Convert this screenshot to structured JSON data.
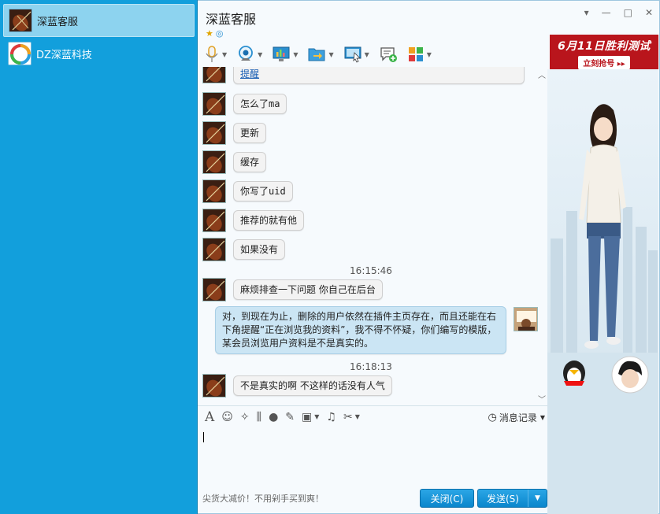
{
  "contacts": [
    {
      "name": "深蓝客服",
      "active": true
    },
    {
      "name": "DZ深蓝科技",
      "active": false
    }
  ],
  "chat": {
    "title": "深蓝客服",
    "window_controls": {
      "menu": "▾",
      "minimize": "—",
      "maximize": "□",
      "close": "✕"
    }
  },
  "ad": {
    "line1": "6月11日胜利测试",
    "line2": "立刻抢号 ▸▸"
  },
  "messages": [
    {
      "text": "提醒"
    },
    {
      "text": "怎么了ma"
    },
    {
      "text": "更新"
    },
    {
      "text": "缓存"
    },
    {
      "text": "你写了uid"
    },
    {
      "text": "推荐的就有他"
    },
    {
      "text": "如果没有"
    },
    {
      "timestamp": "16:15:46"
    },
    {
      "text": "麻烦排查一下问题 你自己在后台"
    },
    {
      "self": "对，到现在为止，删除的用户依然在插件主页存在，而且还能在右下角提醒“正在浏览我的资料”，我不得不怀疑，你们编写的模版，某会员浏览用户资料是不是真实的。"
    },
    {
      "timestamp": "16:18:13"
    },
    {
      "text": "不是真实的啊 不这样的话没有人气"
    }
  ],
  "input": {
    "history_label": "消息记录",
    "promo": "尖货大减价！不用剁手买到爽！",
    "close_label": "关闭(C)",
    "send_label": "发送(S)"
  },
  "colors": {
    "sidebar": "#129fdc",
    "accent": "#0a86cc",
    "ad_red": "#b9151c"
  }
}
